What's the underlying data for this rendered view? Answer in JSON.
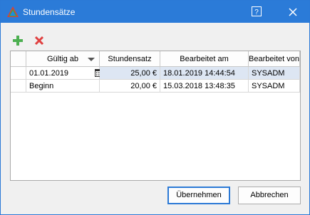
{
  "window": {
    "title": "Stundensätze",
    "help_label": "?",
    "title_bg": "#2b7bd8"
  },
  "toolbar": {
    "add_icon": "plus-icon",
    "delete_icon": "x-icon",
    "add_color": "#4caf50",
    "delete_color": "#e04040"
  },
  "grid": {
    "columns": [
      "Gültig ab",
      "Stundensatz",
      "Bearbeitet am",
      "Bearbeitet von"
    ],
    "rows": [
      {
        "gueltig_ab": "01.01.2019",
        "stundensatz": "25,00 €",
        "bearbeitet_am": "18.01.2019 14:44:54",
        "bearbeitet_von": "SYSADM"
      },
      {
        "gueltig_ab": "Beginn",
        "stundensatz": "20,00 €",
        "bearbeitet_am": "15.03.2018 13:48:35",
        "bearbeitet_von": "SYSADM"
      }
    ],
    "selected_bg": "#dde6f3"
  },
  "buttons": {
    "ok": "Übernehmen",
    "cancel": "Abbrechen"
  }
}
